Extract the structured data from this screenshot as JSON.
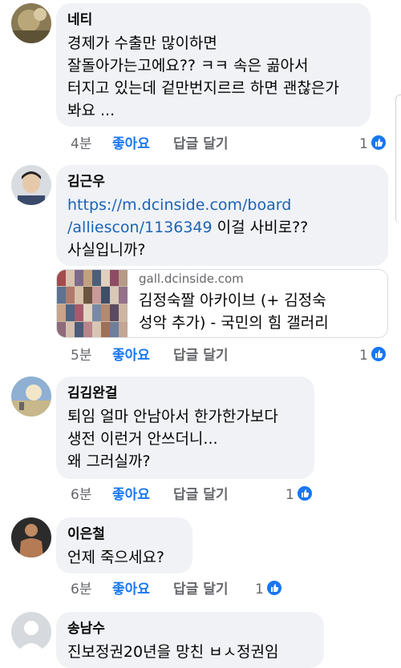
{
  "comments": [
    {
      "author": "네티",
      "text": "경제가 수출만 많이하면\n잘돌아가는고에요?? ㅋㅋ 속은 곪아서\n터지고 있는데 겉만번지르르 하면 괜찮은가\n봐요 ...",
      "time": "4분",
      "like_label": "좋아요",
      "reply_label": "답글 달기",
      "reaction_count": "1"
    },
    {
      "author": "김근우",
      "link_text": "https://m.dcinside.com/board\n/alliescon/1136349",
      "text": " 이걸 사비로??\n사실입니까?",
      "preview_domain": "gall.dcinside.com",
      "preview_title": "김정숙짤 아카이브 (+ 김정숙\n성악 추가) - 국민의 힘 갤러리",
      "time": "5분",
      "like_label": "좋아요",
      "reply_label": "답글 달기",
      "reaction_count": "1"
    },
    {
      "author": "김김완걸",
      "text": "퇴임 얼마 안남아서 한가한가보다\n생전 이런거 안쓰더니...\n왜 그러실까?",
      "time": "6분",
      "like_label": "좋아요",
      "reply_label": "답글 달기",
      "reaction_count": "1"
    },
    {
      "author": "이은철",
      "text": "언제 죽으세요?",
      "time": "6분",
      "like_label": "좋아요",
      "reply_label": "답글 달기",
      "reaction_count": "1"
    },
    {
      "author": "송남수",
      "text": "진보정권20년을 망친 ㅂㅅ정권임"
    }
  ],
  "colors": {
    "bubble": "#f0f2f5",
    "like": "#1877f2",
    "meta": "#65676b",
    "link": "#1c63b7"
  }
}
